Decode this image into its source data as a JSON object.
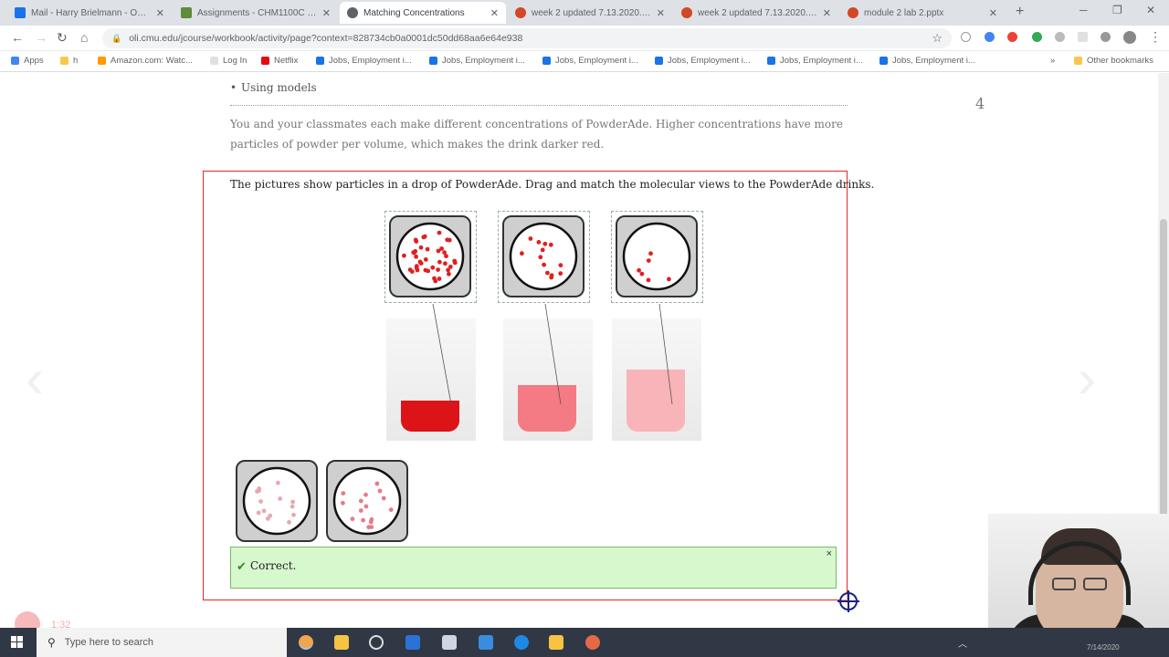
{
  "browser": {
    "tabs": [
      {
        "title": "Mail - Harry Brielmann - Outlo",
        "icon_color": "#1a73e8",
        "active": false
      },
      {
        "title": "Assignments - CHM1100C Ser",
        "icon_color": "#5f8b3a",
        "active": false
      },
      {
        "title": "Matching Concentrations",
        "icon_color": "#5f6368",
        "active": true
      },
      {
        "title": "week 2 updated 7.13.2020.pptx",
        "icon_color": "#d24726",
        "active": false
      },
      {
        "title": "week 2 updated 7.13.2020.pptx",
        "icon_color": "#d24726",
        "active": false
      },
      {
        "title": "module 2 lab 2.pptx",
        "icon_color": "#d24726",
        "active": false
      }
    ],
    "new_tab": "+",
    "url": "oli.cmu.edu/jcourse/workbook/activity/page?context=828734cb0a0001dc50dd68aa6e64e938",
    "bookmarks": [
      "Apps",
      "h",
      "Amazon.com: Watc...",
      "Log In",
      "Netflix",
      "Jobs, Employment i...",
      "Jobs, Employment i...",
      "Jobs, Employment i...",
      "Jobs, Employment i...",
      "Jobs, Employment i...",
      "Jobs, Employment i..."
    ],
    "bookmarks_more": "»",
    "other_bookmarks": "Other bookmarks"
  },
  "page": {
    "bullet": "Using models",
    "page_number": "4",
    "intro": "You and your classmates each make different concentrations of PowderAde. Higher concentrations have more particles of powder per volume, which makes the drink darker red.",
    "instructions": "The pictures show particles in a drop of PowderAde. Drag and match the molecular views to the PowderAde drinks.",
    "feedback": "Correct.",
    "feedback_close": "×"
  },
  "particle_views": {
    "matched": [
      {
        "level": "high",
        "dots": 40,
        "color": "#e02020"
      },
      {
        "level": "medium",
        "dots": 13,
        "color": "#e02020"
      },
      {
        "level": "low",
        "dots": 6,
        "color": "#e02020"
      }
    ],
    "tray": [
      {
        "level": "very-low",
        "dots": 14,
        "color": "#e8a8b0"
      },
      {
        "level": "low-medium",
        "dots": 16,
        "color": "#e87a8a"
      }
    ]
  },
  "drinks": [
    {
      "color": "#dc1418",
      "fill_level": 0.3
    },
    {
      "color": "#f47b83",
      "fill_level": 0.45
    },
    {
      "color": "#f8b4b8",
      "fill_level": 0.6
    }
  ],
  "recorder": {
    "time": "1:32"
  },
  "taskbar": {
    "search_placeholder": "Type here to search",
    "time": "7/14/2020"
  }
}
